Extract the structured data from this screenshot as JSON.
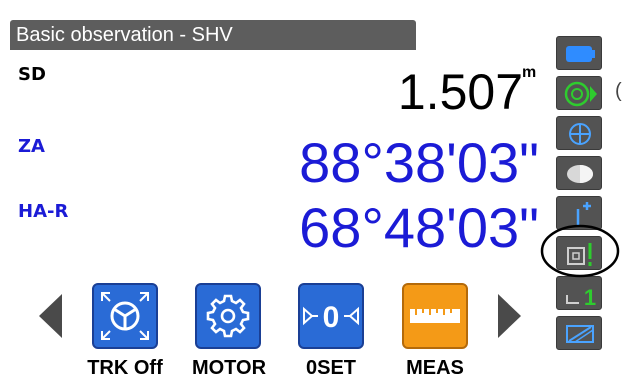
{
  "title": "Basic observation - SHV",
  "measurements": [
    {
      "label": "SD",
      "value": "1.507",
      "unit": "m",
      "color": "#000000"
    },
    {
      "label": "ZA",
      "value": "88°38'03\"",
      "color": "#1b1bd6"
    },
    {
      "label": "HA-R",
      "value": "68°48'03\"",
      "color": "#1b1bd6"
    }
  ],
  "function_keys": [
    {
      "label": "TRK Off",
      "icon": "tracking-icon",
      "color": "#2a6bd6"
    },
    {
      "label": "MOTOR",
      "icon": "gear-icon",
      "color": "#2a6bd6"
    },
    {
      "label": "0SET",
      "icon": "zero-set-icon",
      "color": "#2a6bd6"
    },
    {
      "label": "MEAS",
      "icon": "ruler-icon",
      "color": "#f49a17"
    }
  ],
  "side_panel": {
    "items": [
      "battery-icon",
      "target-prism-icon",
      "laser-plummet-icon",
      "face-icon",
      "tilt-plus-icon",
      "edm-mode-icon",
      "level-1-icon",
      "screen-icon"
    ],
    "partial_text": "("
  },
  "colors": {
    "title_bg": "#5d5d5d",
    "value_blue": "#1b1bd6",
    "nav_arrow": "#4a4a4a",
    "side_bg": "#535353",
    "accent_green": "#2ecc2e"
  }
}
